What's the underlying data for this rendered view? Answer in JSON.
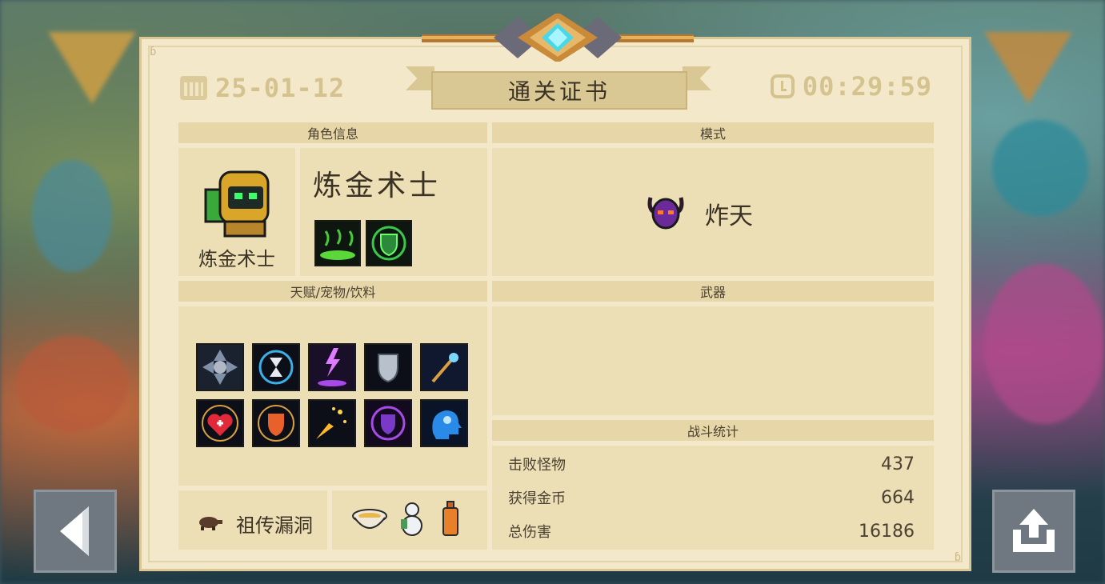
{
  "header": {
    "date": "25-01-12",
    "title": "通关证书",
    "time": "00:29:59",
    "date_icon": "calendar-icon",
    "time_icon": "clock-icon"
  },
  "character": {
    "section_label": "角色信息",
    "name": "炼金术士",
    "portrait_name": "炼金术士",
    "skills": [
      "poison-cloud-skill-icon",
      "green-shield-skill-icon"
    ]
  },
  "mode": {
    "section_label": "模式",
    "name": "炸天",
    "icon": "purple-demon-mask-icon"
  },
  "talents": {
    "section_label": "天赋/宠物/饮料",
    "icons": [
      "spinning-blades-talent-icon",
      "hourglass-talent-icon",
      "purple-lightning-talent-icon",
      "silver-shield-talent-icon",
      "magic-staff-talent-icon",
      "red-heart-heal-talent-icon",
      "fire-shield-talent-icon",
      "golden-sparks-talent-icon",
      "purple-shield-talent-icon",
      "blue-brain-talent-icon"
    ],
    "pet_icon": "turtle-pet-icon",
    "pet_label": "祖传漏洞",
    "drinks": [
      "noodle-bowl-icon",
      "snowman-drink-icon",
      "orange-bottle-icon"
    ]
  },
  "weapons": {
    "section_label": "武器"
  },
  "stats": {
    "section_label": "战斗统计",
    "rows": [
      {
        "label": "击败怪物",
        "value": "437"
      },
      {
        "label": "获得金币",
        "value": "664"
      },
      {
        "label": "总伤害",
        "value": "16186"
      }
    ]
  },
  "colors": {
    "panel": "#f3e8c9",
    "section": "#eddfb5",
    "text": "#3a3325"
  }
}
